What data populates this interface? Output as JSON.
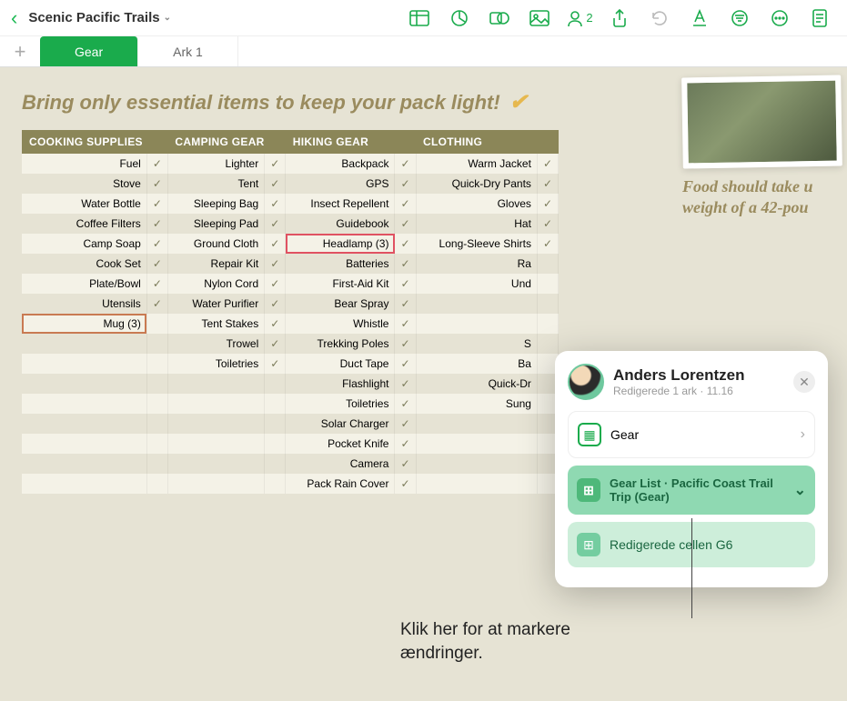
{
  "doc": {
    "title": "Scenic Pacific Trails"
  },
  "tabs": {
    "active": "Gear",
    "other": "Ark 1"
  },
  "heading": "Bring only essential items to keep your pack light!",
  "headers": {
    "c1": "COOKING SUPPLIES",
    "c2": "CAMPING GEAR",
    "c3": "HIKING GEAR",
    "c4": "CLOTHING"
  },
  "cells": {
    "r0c0": "Fuel",
    "r0c1": "Lighter",
    "r0c2": "Backpack",
    "r0c3": "Warm Jacket",
    "r1c0": "Stove",
    "r1c1": "Tent",
    "r1c2": "GPS",
    "r1c3": "Quick-Dry Pants",
    "r2c0": "Water Bottle",
    "r2c1": "Sleeping Bag",
    "r2c2": "Insect Repellent",
    "r2c3": "Gloves",
    "r3c0": "Coffee Filters",
    "r3c1": "Sleeping Pad",
    "r3c2": "Guidebook",
    "r3c3": "Hat",
    "r4c0": "Camp Soap",
    "r4c1": "Ground Cloth",
    "r4c2": "Headlamp (3)",
    "r4c3": "Long-Sleeve Shirts",
    "r5c0": "Cook Set",
    "r5c1": "Repair Kit",
    "r5c2": "Batteries",
    "r5c3": "Ra",
    "r6c0": "Plate/Bowl",
    "r6c1": "Nylon Cord",
    "r6c2": "First-Aid Kit",
    "r6c3": "Und",
    "r7c0": "Utensils",
    "r7c1": "Water Purifier",
    "r7c2": "Bear Spray",
    "r7c3": "",
    "r8c0": "Mug (3)",
    "r8c1": "Tent Stakes",
    "r8c2": "Whistle",
    "r8c3": "",
    "r9c0": "",
    "r9c1": "Trowel",
    "r9c2": "Trekking Poles",
    "r9c3": "S",
    "r10c0": "",
    "r10c1": "Toiletries",
    "r10c2": "Duct Tape",
    "r10c3": "Ba",
    "r11c0": "",
    "r11c1": "",
    "r11c2": "Flashlight",
    "r11c3": "Quick-Dr",
    "r12c0": "",
    "r12c1": "",
    "r12c2": "Toiletries",
    "r12c3": "Sung",
    "r13c0": "",
    "r13c1": "",
    "r13c2": "Solar Charger",
    "r13c3": "",
    "r14c0": "",
    "r14c1": "",
    "r14c2": "Pocket Knife",
    "r14c3": "",
    "r15c0": "",
    "r15c1": "",
    "r15c2": "Camera",
    "r15c3": "",
    "r16c0": "",
    "r16c1": "",
    "r16c2": "Pack Rain Cover",
    "r16c3": ""
  },
  "chk": {
    "r0": [
      "1",
      "1",
      "1",
      "1"
    ],
    "r1": [
      "1",
      "1",
      "1",
      "1"
    ],
    "r2": [
      "1",
      "1",
      "1",
      "1"
    ],
    "r3": [
      "1",
      "1",
      "1",
      "1"
    ],
    "r4": [
      "1",
      "1",
      "1",
      "1"
    ],
    "r5": [
      "1",
      "1",
      "1",
      ""
    ],
    "r6": [
      "1",
      "1",
      "1",
      ""
    ],
    "r7": [
      "1",
      "1",
      "1",
      ""
    ],
    "r8": [
      "",
      "1",
      "1",
      ""
    ],
    "r9": [
      "",
      "1",
      "1",
      ""
    ],
    "r10": [
      "",
      "1",
      "1",
      ""
    ],
    "r11": [
      "",
      "",
      "1",
      ""
    ],
    "r12": [
      "",
      "",
      "1",
      ""
    ],
    "r13": [
      "",
      "",
      "1",
      ""
    ],
    "r14": [
      "",
      "",
      "1",
      ""
    ],
    "r15": [
      "",
      "",
      "1",
      ""
    ],
    "r16": [
      "",
      "",
      "1",
      ""
    ]
  },
  "side_note": "Food should take u\nweight of a 42-pou",
  "collab": {
    "name": "Anders Lorentzen",
    "sub": "Redigerede 1 ark · 11.16",
    "item_sheet": "Gear",
    "item_table": "Gear List · Pacific Coast Trail Trip (Gear)",
    "item_cell": "Redigerede cellen G6"
  },
  "callout": "Klik her for at markere\nændringer.",
  "toolbar_people_count": "2"
}
